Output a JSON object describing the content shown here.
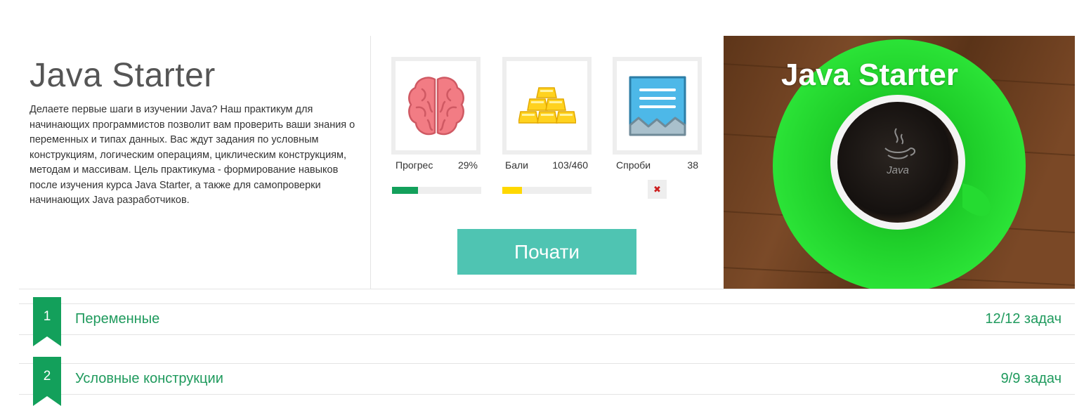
{
  "course": {
    "title": "Java Starter",
    "description": "Делаете первые шаги в изучении Java? Наш практикум для начинающих программистов позволит вам проверить ваши знания о переменных и типах данных. Вас ждут задания по условным конструкциям, логическим операциям, циклическим конструкциям, методам и массивам. Цель практикума - формирование навыков после изучения курса Java Starter, а также для самопроверки начинающих Java разработчиков."
  },
  "stats": {
    "progress": {
      "label": "Прогрес",
      "value": "29%",
      "fraction": 0.29,
      "color": "#13a05b",
      "icon": "brain-icon"
    },
    "points": {
      "label": "Бали",
      "value": "103/460",
      "fraction": 0.224,
      "color": "#ffd800",
      "icon": "gold-bars-icon"
    },
    "attempts": {
      "label": "Спроби",
      "value": "38",
      "icon": "document-icon",
      "status_icon": "close-icon",
      "status_glyph": "✖"
    }
  },
  "actions": {
    "start_label": "Почати",
    "start_color": "#4fc4b2"
  },
  "banner": {
    "title": "Java Starter",
    "logo_text": "Java",
    "colors": {
      "saucer": "#21d62c",
      "table": "#6b3f22",
      "coffee": "#1a1512"
    }
  },
  "modules": [
    {
      "number": "1",
      "title": "Переменные",
      "count": "12/12 задач"
    },
    {
      "number": "2",
      "title": "Условные конструкции",
      "count": "9/9 задач"
    }
  ],
  "theme": {
    "accent": "#1f9a5d",
    "ribbon": "#13a05b"
  }
}
